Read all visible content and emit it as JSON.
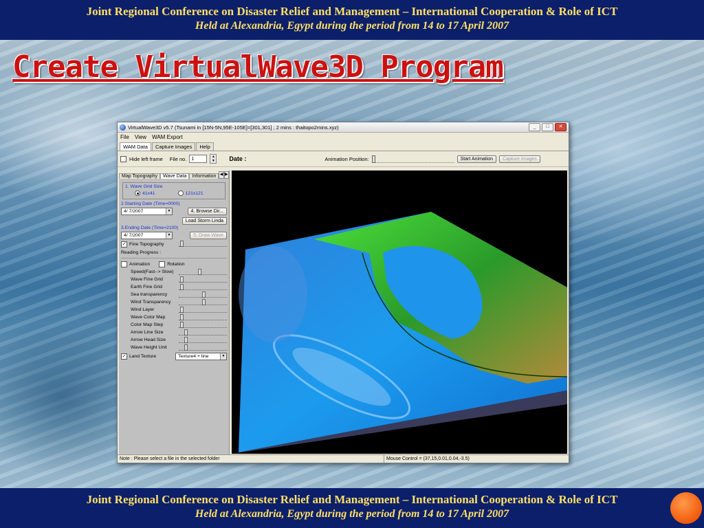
{
  "banner": {
    "line1": "Joint Regional Conference on Disaster Relief and Management – International Cooperation & Role of ICT",
    "line2": "Held at Alexandria, Egypt  during the period from 14 to 17 April 2007"
  },
  "slide_title": "Create VirtualWave3D Program",
  "window": {
    "title": "VirtualWave3D v5.7 (Tsunami in [15N-5N,95E-105E]=[301,301] ; 2 mins : thaitopo2mins.xyz)",
    "buttons": {
      "minimize": "_",
      "maximize": "□",
      "close": "✕"
    }
  },
  "menu": [
    "File",
    "View",
    "WAM Export"
  ],
  "top_tabs": [
    "WAM Data",
    "Capture Images",
    "Help"
  ],
  "toolbar": {
    "hide_left_frame": "Hide left frame",
    "file_no_label": "File no.",
    "file_no_value": "1",
    "date_label": "Date :",
    "animation_position": "Animation Position:",
    "start_animation": "Start Animation",
    "capture_images": "Capture Images"
  },
  "left_tabs": [
    "Map Topography",
    "Wave Data",
    "Information"
  ],
  "panel": {
    "grid_size_label": "1. Wave Grid Size",
    "grid_opt1": "41x41",
    "grid_opt2": "121x121",
    "starting_date_label": "2.Starting Date (Time=0000)",
    "starting_date": "4/ 7/2007",
    "browse_button": "4.  Browse Dir...",
    "load_storm_button": "Load Storm Linda",
    "ending_date_label": "3.Ending Date (Time=2100)",
    "ending_date": "4/ 7/2007",
    "draw_wave_button": "5.  Draw Wave",
    "fine_topography": "Fine Topography",
    "reading_progress": "Reading Progress :",
    "animation": "Animation",
    "rotation": "Rotation",
    "params": [
      "Speed(Fast--> Slow)",
      "Wave Fine Grid",
      "Earth Fine Grid",
      "Sea transparency",
      "Wind Transparency",
      "Wind Layer",
      "Wave Color Map",
      "Color Map Step",
      "Arrow Line Size",
      "Arrow Head Size",
      "Wave Height Unit"
    ],
    "land_texture": "Land Texture",
    "texture_value": "Texture4 + line"
  },
  "status": {
    "note": "Note : Please select a file in the selected folder",
    "mouse": "Mouse Control = (37,15,0.01,0.04,-3.5)"
  }
}
